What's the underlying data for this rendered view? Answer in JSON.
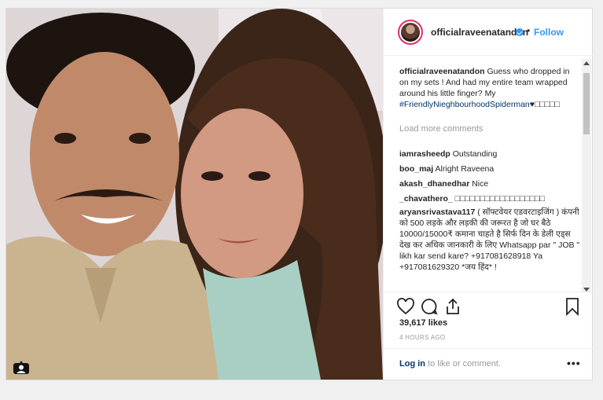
{
  "post": {
    "username": "officialraveenatandon",
    "dot": "•",
    "follow_label": "Follow"
  },
  "caption": {
    "username": "officialraveenatandon",
    "text_before": "Guess who dropped in on my sets ! And had my entire team wrapped around his little finger? My ",
    "hashtag": "#FriendlyNieghbourhoodSpiderman",
    "text_after": "♥□□□□□"
  },
  "load_more_label": "Load more comments",
  "comments": [
    {
      "username": "iamrasheedp",
      "text": "Outstanding"
    },
    {
      "username": "boo_maj",
      "text": "Alright Raveena"
    },
    {
      "username": "akash_dhanedhar",
      "text": "Nice"
    },
    {
      "username": "_chavathero_",
      "text": "□□□□□□□□□□□□□□□□□□"
    },
    {
      "username": "aryansrivastava117",
      "text": "( सॉफ्टवेयर एडवरटाइजिंग ) कंपनी को 500 लड़के और लड़की की जरूरत है जो घर बैठे 10000/15000₹ कमाना चाहते है सिर्फ दिन के डेली एड्स देख कर अधिक जानकारी के लिए Whatsapp par \" JOB \" likh kar send kare? +917081628918 Ya +917081629320 *जय हिंद* !"
    }
  ],
  "likes": "39,617 likes",
  "time_ago": "4 HOURS AGO",
  "login": {
    "link": "Log in",
    "text": " to like or comment."
  },
  "more_label": "•••",
  "icons": [
    "heart-icon",
    "comment-icon",
    "share-icon",
    "bookmark-icon",
    "tag-user-icon",
    "verified-icon",
    "more-options-icon"
  ],
  "colors": {
    "accent": "#3897f0",
    "text": "#262626",
    "muted": "#999999",
    "hashtag": "#003569"
  }
}
